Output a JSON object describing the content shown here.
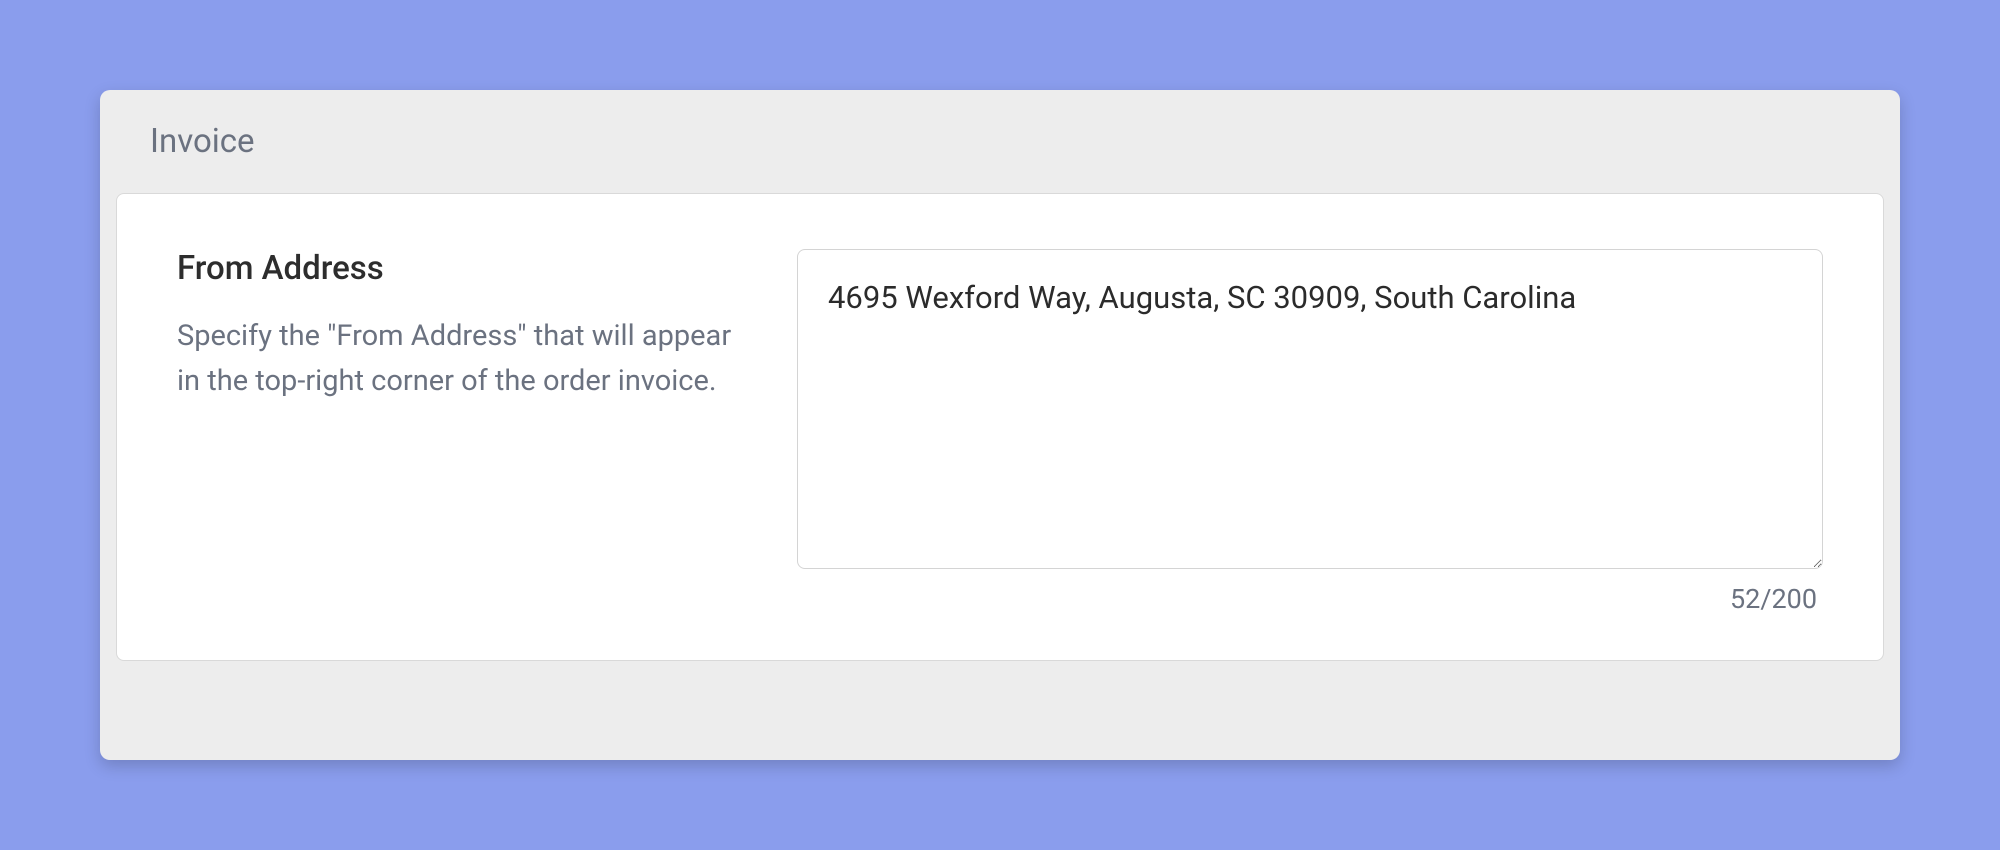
{
  "card": {
    "title": "Invoice"
  },
  "from_address": {
    "label": "From Address",
    "description": "Specify the \"From Address\" that will appear in the top-right corner of the order invoice.",
    "value": "4695 Wexford Way, Augusta, SC 30909, South Carolina",
    "counter": "52/200"
  }
}
